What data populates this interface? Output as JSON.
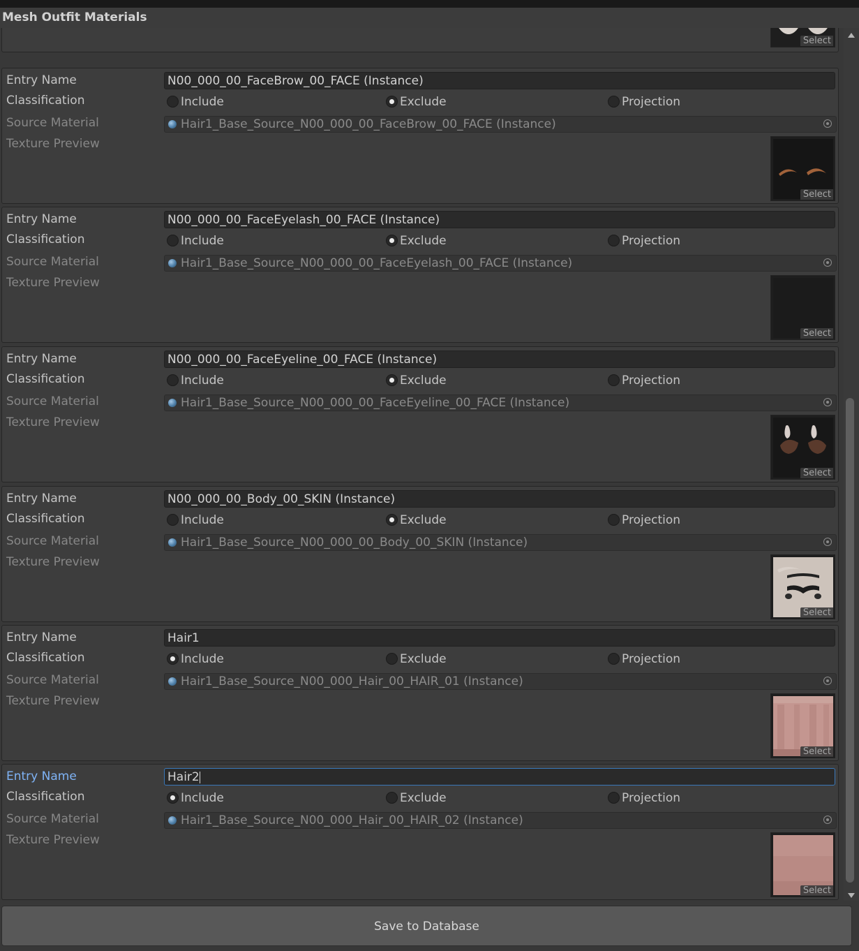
{
  "window": {
    "title": "Mesh Outfit Materials"
  },
  "labels": {
    "entry_name": "Entry Name",
    "classification": "Classification",
    "source_material": "Source Material",
    "texture_preview": "Texture Preview",
    "select": "Select",
    "include": "Include",
    "exclude": "Exclude",
    "projection": "Projection"
  },
  "entries": [
    {
      "name": "N00_000_00_FaceBrow_00_FACE (Instance)",
      "classification": "Exclude",
      "source_material": "Hair1_Base_Source_N00_000_00_FaceBrow_00_FACE (Instance)",
      "texture": "face-brow-texture"
    },
    {
      "name": "N00_000_00_FaceEyelash_00_FACE (Instance)",
      "classification": "Exclude",
      "source_material": "Hair1_Base_Source_N00_000_00_FaceEyelash_00_FACE (Instance)",
      "texture": "face-eyelash-texture"
    },
    {
      "name": "N00_000_00_FaceEyeline_00_FACE (Instance)",
      "classification": "Exclude",
      "source_material": "Hair1_Base_Source_N00_000_00_FaceEyeline_00_FACE (Instance)",
      "texture": "face-eyeline-texture"
    },
    {
      "name": "N00_000_00_Body_00_SKIN (Instance)",
      "classification": "Exclude",
      "source_material": "Hair1_Base_Source_N00_000_00_Body_00_SKIN (Instance)",
      "texture": "body-skin-texture"
    },
    {
      "name": "Hair1",
      "classification": "Include",
      "source_material": "Hair1_Base_Source_N00_000_Hair_00_HAIR_01 (Instance)",
      "texture": "hair-01-texture"
    },
    {
      "name": "Hair2",
      "classification": "Include",
      "source_material": "Hair1_Base_Source_N00_000_Hair_00_HAIR_02 (Instance)",
      "texture": "hair-02-texture",
      "focused": true
    }
  ],
  "footer": {
    "save_label": "Save to Database"
  },
  "colors": {
    "accent": "#3a79bb",
    "focused_label": "#7fb3f5",
    "panel": "#3d3d3d",
    "background": "#383838"
  },
  "icons": {
    "material": "material-sphere-icon",
    "picker": "object-picker-icon",
    "scroll_up": "scroll-up-arrow-icon",
    "scroll_down": "scroll-down-arrow-icon"
  }
}
